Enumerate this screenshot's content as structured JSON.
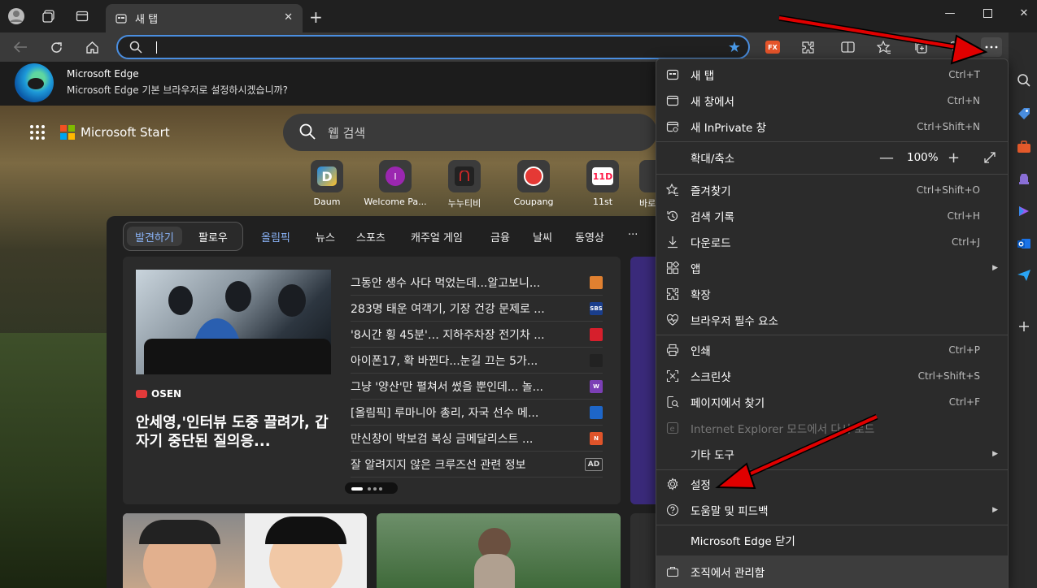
{
  "tab": {
    "title": "새 탭"
  },
  "banner": {
    "title": "Microsoft Edge",
    "subtitle": "Microsoft Edge 기본 브라우저로 설정하시겠습니까?"
  },
  "start": {
    "brand": "Microsoft Start",
    "search_placeholder": "웹 검색"
  },
  "quick_links": [
    {
      "label": "Daum",
      "color": "#1e88e5"
    },
    {
      "label": "Welcome Pa...",
      "color": "#9b27b0"
    },
    {
      "label": "누누티비",
      "color": "#c62828"
    },
    {
      "label": "Coupang",
      "color": "#e53935"
    },
    {
      "label": "11st",
      "color": "#ff1744"
    },
    {
      "label": "바로",
      "color": "#666666"
    }
  ],
  "feed_tabs": {
    "discover": "발견하기",
    "follow": "팔로우"
  },
  "nav": [
    "올림픽",
    "뉴스",
    "스포츠",
    "캐주얼 게임",
    "금융",
    "날씨",
    "동영상",
    "···"
  ],
  "main_story": {
    "source": "OSEN",
    "headline": "안세영,'인터뷰 도중 끌려가, 갑자기 중단된 질의응..."
  },
  "news": [
    {
      "title": "그동안 생수 사다 먹었는데...알고보니...",
      "src": "",
      "src_color": "#e08030"
    },
    {
      "title": "283명 태운 여객기, 기장 건강 문제로 ...",
      "src": "SBS",
      "src_color": "#1a3e8c"
    },
    {
      "title": "'8시간 횡 45분'… 지하주차장 전기차 ...",
      "src": "",
      "src_color": "#d61f2c"
    },
    {
      "title": "아이폰17, 확 바뀐다...눈길 끄는 5가...",
      "src": "",
      "src_color": "#222222"
    },
    {
      "title": "그냥 '양산'만 펼쳐서 썼을 뿐인데... 놀...",
      "src": "W",
      "src_color": "#7b3fb5"
    },
    {
      "title": "[올림픽] 루마니아 총리, 자국 선수 메...",
      "src": "",
      "src_color": "#1e66c8"
    },
    {
      "title": "만신창이 박보검 복싱 금메달리스트 ...",
      "src": "N",
      "src_color": "#e0542a"
    },
    {
      "title": "잘 알려지지 않은 크루즈선 관련 정보",
      "src": "AD",
      "src_color": "#2b2b2b"
    }
  ],
  "menu": {
    "new_tab": {
      "label": "새 탭",
      "shortcut": "Ctrl+T"
    },
    "new_window": {
      "label": "새 창에서",
      "shortcut": "Ctrl+N"
    },
    "new_inprivate": {
      "label": "새 InPrivate 창",
      "shortcut": "Ctrl+Shift+N"
    },
    "zoom": {
      "label": "확대/축소",
      "value": "100%"
    },
    "favorites": {
      "label": "즐겨찾기",
      "shortcut": "Ctrl+Shift+O"
    },
    "history": {
      "label": "검색 기록",
      "shortcut": "Ctrl+H"
    },
    "downloads": {
      "label": "다운로드",
      "shortcut": "Ctrl+J"
    },
    "apps": {
      "label": "앱"
    },
    "extensions": {
      "label": "확장"
    },
    "essentials": {
      "label": "브라우저 필수 요소"
    },
    "print": {
      "label": "인쇄",
      "shortcut": "Ctrl+P"
    },
    "screenshot": {
      "label": "스크린샷",
      "shortcut": "Ctrl+Shift+S"
    },
    "find": {
      "label": "페이지에서 찾기",
      "shortcut": "Ctrl+F"
    },
    "ie_mode": {
      "label": "Internet Explorer 모드에서 다시 로드"
    },
    "more_tools": {
      "label": "기타 도구"
    },
    "settings": {
      "label": "설정"
    },
    "help": {
      "label": "도움말 및 피드백"
    },
    "close_edge": {
      "label": "Microsoft Edge 닫기"
    },
    "managed": {
      "label": "조직에서 관리함"
    }
  },
  "colors": {
    "accent": "#4a8ee0",
    "annotation_arrow": "#e00000"
  }
}
